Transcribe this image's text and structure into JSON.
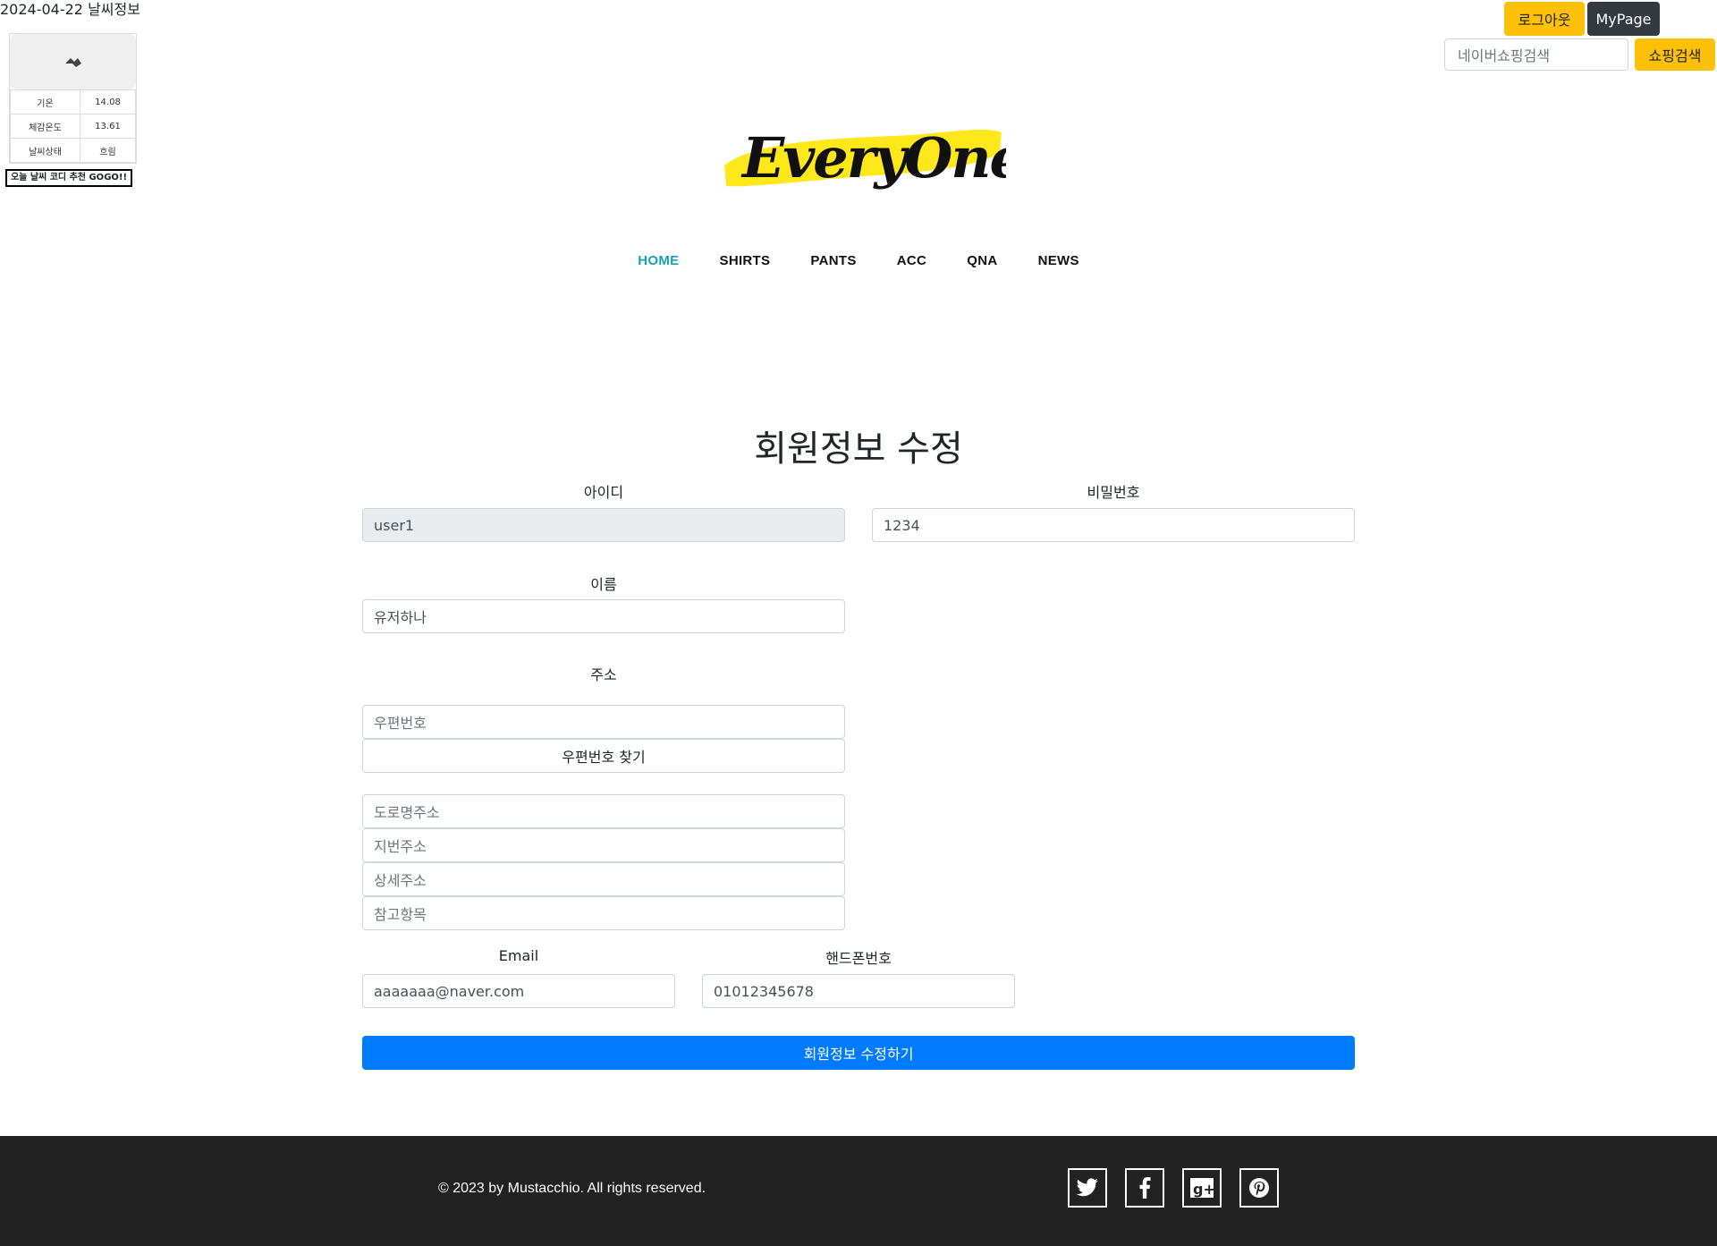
{
  "weather": {
    "header": "2024-04-22 날씨정보",
    "rows": [
      {
        "label": "기온",
        "value": "14.08"
      },
      {
        "label": "체감온도",
        "value": "13.61"
      },
      {
        "label": "날씨상태",
        "value": "흐림"
      }
    ],
    "button": "오늘 날씨 코디 추천 GOGO!!",
    "icon": "cloud-icon"
  },
  "topbar": {
    "logout": "로그아웃",
    "mypage": "MyPage",
    "search_placeholder": "네이버쇼핑검색",
    "search_button": "쇼핑검색"
  },
  "logo": {
    "text": "EveryOne",
    "highlight_color": "#ffe600"
  },
  "nav": {
    "items": [
      "HOME",
      "SHIRTS",
      "PANTS",
      "ACC",
      "QNA",
      "NEWS"
    ],
    "active": "HOME"
  },
  "form": {
    "title": "회원정보 수정",
    "id_label": "아이디",
    "id_value": "user1",
    "pw_label": "비밀번호",
    "pw_value": "1234",
    "name_label": "이름",
    "name_value": "유저하나",
    "address_label": "주소",
    "postcode_placeholder": "우편번호",
    "postcode_button": "우편번호 찾기",
    "road_placeholder": "도로명주소",
    "jibun_placeholder": "지번주소",
    "detail_placeholder": "상세주소",
    "extra_placeholder": "참고항목",
    "email_label": "Email",
    "email_value": "aaaaaaa@naver.com",
    "phone_label": "핸드폰번호",
    "phone_value": "01012345678",
    "submit": "회원정보 수정하기"
  },
  "footer": {
    "copyright": "© 2023 by Mustacchio. All rights reserved.",
    "social": [
      "twitter-icon",
      "facebook-icon",
      "google-plus-icon",
      "pinterest-icon"
    ]
  },
  "colors": {
    "accent_yellow": "#ffc107",
    "primary_blue": "#007bff",
    "nav_active": "#17a2b8",
    "footer_bg": "#222222"
  }
}
